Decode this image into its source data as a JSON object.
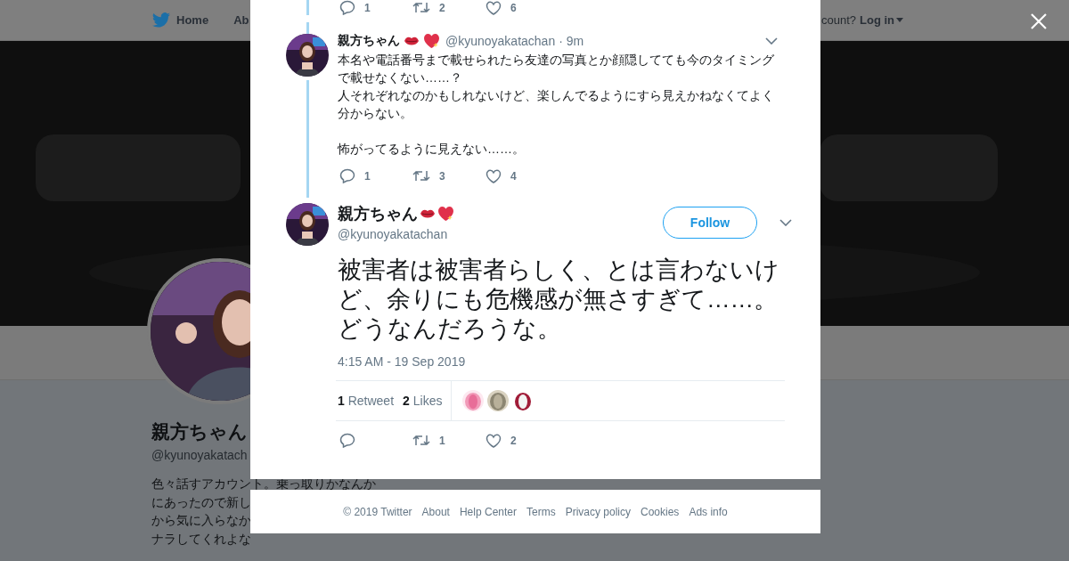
{
  "nav": {
    "items": [
      {
        "label": "Home"
      },
      {
        "label": "Ab"
      }
    ],
    "account_prompt": "count?",
    "login": "Log in"
  },
  "profile": {
    "name": "親方ちゃん",
    "handle": "@kyunoyakatach",
    "bio_lines": [
      "色々話すアカウント。乗っ取りかなんか",
      "にあったので新し",
      "から気に入らなか",
      "ナラしてくれよな"
    ]
  },
  "thread": {
    "previous_actions": {
      "replies": "1",
      "retweets": "2",
      "likes": "6"
    },
    "reply": {
      "name": "親方ちゃん",
      "handle": "@kyunoyakatachan",
      "separator": "·",
      "time": "9m",
      "paragraphs": [
        {
          "lines": [
            "本名や電話番号まで載せられたら友達の写真とか顔隠してても今のタイミングで載せなくない……？",
            "人それぞれなのかもしれないけど、楽しんでるようにすら見えかねなくてよく分からない。"
          ]
        },
        {
          "lines": [
            "怖がってるように見えない……。"
          ]
        }
      ],
      "replies": "1",
      "retweets": "3",
      "likes": "4"
    },
    "main": {
      "name": "親方ちゃん",
      "handle": "@kyunoyakatachan",
      "follow": "Follow",
      "text": "被害者は被害者らしく、とは言わないけど、余りにも危機感が無さすぎて……。どうなんだろうな。",
      "timestamp": "4:15 AM - 19 Sep 2019",
      "retweet_count": "1",
      "retweet_label": "Retweet",
      "like_count": "2",
      "like_label": "Likes",
      "retweets": "1",
      "likes": "2"
    }
  },
  "footer": {
    "links": [
      "© 2019 Twitter",
      "About",
      "Help Center",
      "Terms",
      "Privacy policy",
      "Cookies",
      "Ads info"
    ]
  }
}
